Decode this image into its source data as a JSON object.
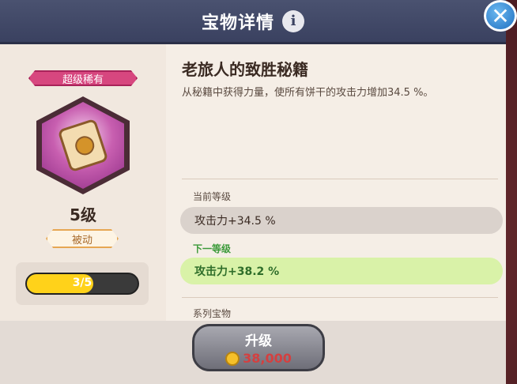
{
  "header": {
    "title": "宝物详情"
  },
  "left": {
    "rarity": "超级稀有",
    "level": "5级",
    "passive": "被动",
    "progress_text": "3/5",
    "progress_value": 0.6
  },
  "detail": {
    "name": "老旅人的致胜秘籍",
    "description": "从秘籍中获得力量，使所有饼干的攻击力增加34.5 %。",
    "current_level_label": "当前等级",
    "current_stat": "攻击力+34.5 %",
    "next_level_label": "下一等级",
    "next_stat": "攻击力+38.2 %",
    "series_label": "系列宝物"
  },
  "upgrade": {
    "label": "升级",
    "cost": "38,000"
  },
  "colors": {
    "accent": "#d7477f",
    "next": "#d9f2a8",
    "coin": "#f5c02a",
    "cost_text": "#d44040"
  }
}
